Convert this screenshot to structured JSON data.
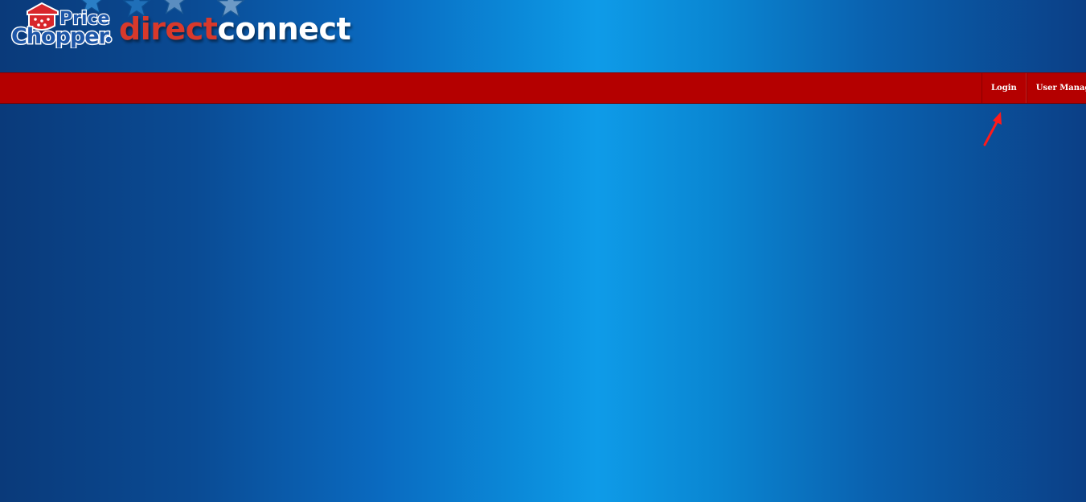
{
  "brand": {
    "logo_text": "Price Chopper",
    "title_part1": "direct",
    "title_part2": "connect"
  },
  "nav": {
    "items": [
      {
        "label": "Login"
      },
      {
        "label": "User Managemen"
      }
    ]
  },
  "colors": {
    "nav_bar": "#b40000",
    "accent_red": "#d8392b",
    "background_center": "#0e9be8",
    "background_edge": "#0a3a7a"
  },
  "icons": {
    "decorative_stars": "star-icon",
    "annotation": "red-arrow-icon"
  }
}
